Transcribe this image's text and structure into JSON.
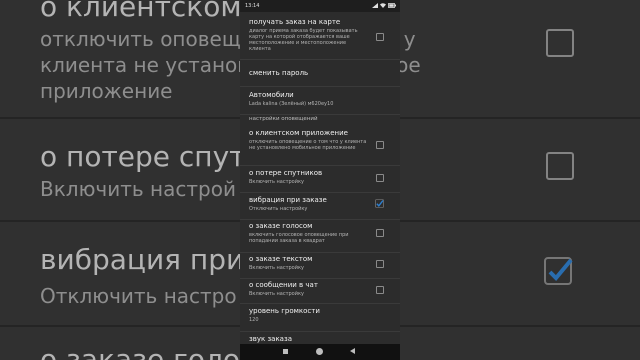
{
  "status_bar": {
    "time": "13:14"
  },
  "background": {
    "lines": [
      {
        "title": "о клиентском",
        "sub1": "отключить оповещение о том что у",
        "sub2": "клиента не установлено мобильное",
        "sub3": "приложение"
      },
      {
        "title": "о потере спутни",
        "sub1": "Включить настрой"
      },
      {
        "title": "вибрация при",
        "sub1": "Отключить настро"
      },
      {
        "title": "о заказе голос"
      }
    ]
  },
  "settings": {
    "map_order": {
      "title": "получать заказ на карте",
      "sub": "диалог приема заказа будет показывать карту на которой отображается ваше местоположение и местоположение клиента",
      "checked": false
    },
    "change_password": {
      "title": "сменить пароль"
    },
    "cars": {
      "title": "Автомобили",
      "sub": "Lada kalina (Зелёный) м620еу10"
    },
    "notifications_header": "настройки оповещений",
    "client_app": {
      "title": "о клиентском приложение",
      "sub": "отключить оповещение о том что у клиента не установлено мобильное приложение",
      "checked": false
    },
    "satellite_loss": {
      "title": "о потере спутников",
      "sub": "Включить настройку",
      "checked": false
    },
    "vibration": {
      "title": "вибрация при заказе",
      "sub": "Отключить настройку",
      "checked": true
    },
    "voice_order": {
      "title": "о заказе голосом",
      "sub": "включить голосовое оповещение при попадании заказа в квадрат",
      "checked": false
    },
    "text_order": {
      "title": "о заказе текстом",
      "sub": "Включить настройку",
      "checked": false
    },
    "chat_message": {
      "title": "о сообщении в чат",
      "sub": "Включить настройку",
      "checked": false
    },
    "volume": {
      "title": "уровень громкости",
      "sub": "120"
    },
    "order_sound": {
      "title": "звук заказа"
    }
  },
  "colors": {
    "accent": "#2d7fd0",
    "background": "#2c2c2c"
  }
}
